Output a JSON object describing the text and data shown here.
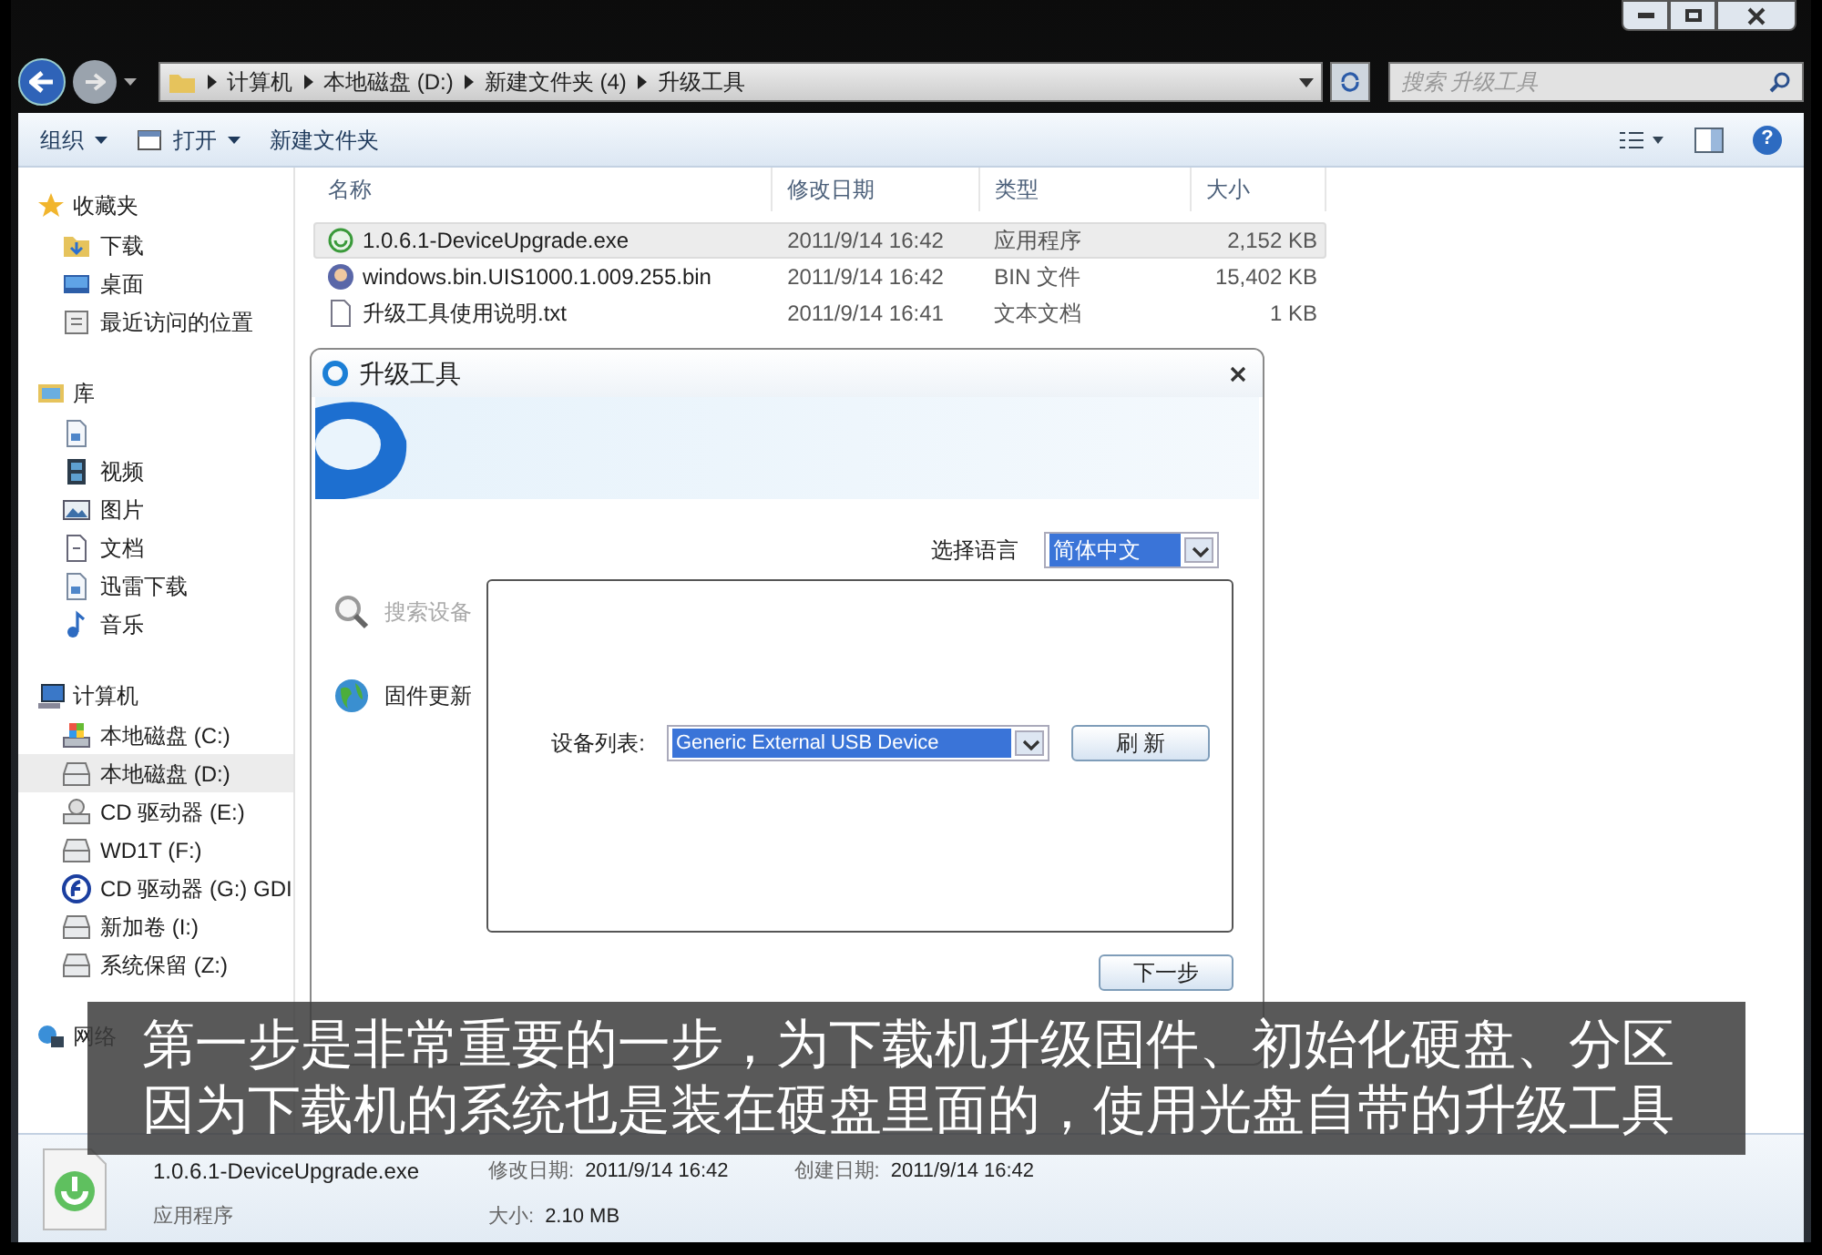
{
  "address_bar": {
    "crumbs": [
      "计算机",
      "本地磁盘 (D:)",
      "新建文件夹 (4)",
      "升级工具"
    ],
    "search": {
      "placeholder": "搜索 升级工具"
    }
  },
  "toolbar": [
    {
      "label": "组织",
      "dropdown": true,
      "kind": "text"
    },
    {
      "label": "打开",
      "dropdown": true,
      "kind": "open"
    },
    {
      "label": "新建文件夹",
      "dropdown": false,
      "kind": "text"
    }
  ],
  "sidebar": [
    {
      "label": "收藏夹",
      "kind": "star",
      "selected": false,
      "children": [
        {
          "label": "下载",
          "kind": "download",
          "selected": false
        },
        {
          "label": "桌面",
          "kind": "desktop",
          "selected": false
        },
        {
          "label": "最近访问的位置",
          "kind": "recent",
          "selected": false
        }
      ]
    },
    {
      "label": "库",
      "kind": "library",
      "selected": false,
      "children": [
        {
          "kind": "file",
          "selected": false
        },
        {
          "label": "视频",
          "kind": "video",
          "selected": false
        },
        {
          "label": "图片",
          "kind": "picture",
          "selected": false
        },
        {
          "label": "文档",
          "kind": "document",
          "selected": false
        },
        {
          "label": "迅雷下载",
          "kind": "file",
          "selected": false
        },
        {
          "label": "音乐",
          "kind": "music",
          "selected": false
        }
      ]
    },
    {
      "label": "计算机",
      "kind": "computer",
      "selected": false,
      "children": [
        {
          "label": "本地磁盘 (C:)",
          "kind": "system-drive",
          "selected": false
        },
        {
          "label": "本地磁盘 (D:)",
          "kind": "drive",
          "selected": true
        },
        {
          "label": "CD 驱动器 (E:)",
          "kind": "cd",
          "selected": false
        },
        {
          "label": "WD1T (F:)",
          "kind": "drive",
          "selected": false
        },
        {
          "label": "CD 驱动器 (G:) GDI",
          "kind": "disc-logo",
          "selected": false
        },
        {
          "label": "新加卷 (I:)",
          "kind": "drive",
          "selected": false
        },
        {
          "label": "系统保留 (Z:)",
          "kind": "drive",
          "selected": false
        }
      ]
    },
    {
      "label": "网络",
      "kind": "network",
      "selected": false
    }
  ],
  "help_button": "?",
  "file_list": {
    "columns": [
      "名称",
      "修改日期",
      "类型",
      "大小"
    ],
    "rows": [
      {
        "name": "1.0.6.1-DeviceUpgrade.exe",
        "date": "2011/9/14 16:42",
        "type": "应用程序",
        "size": "2,152 KB",
        "kind": "exe",
        "selected": true
      },
      {
        "name": "windows.bin.UIS1000.1.009.255.bin",
        "date": "2011/9/14 16:42",
        "type": "BIN 文件",
        "size": "15,402 KB",
        "kind": "bin",
        "selected": false
      },
      {
        "name": "升级工具使用说明.txt",
        "date": "2011/9/14 16:41",
        "type": "文本文档",
        "size": "1 KB",
        "kind": "txt",
        "selected": false
      }
    ]
  },
  "dialog": {
    "title": "升级工具",
    "language_label": "选择语言",
    "language_value": "简体中文",
    "side_items": [
      {
        "label": "搜索设备",
        "kind": "search",
        "disabled": true
      },
      {
        "label": "固件更新",
        "kind": "globe",
        "disabled": false
      }
    ],
    "device_label": "设备列表:",
    "device_value": "Generic External USB Device",
    "refresh_button": "刷 新",
    "next_button": "下一步"
  },
  "details_pane": {
    "name": "1.0.6.1-DeviceUpgrade.exe",
    "type": "应用程序",
    "fields": [
      {
        "label": "修改日期:",
        "value": "2011/9/14 16:42"
      },
      {
        "label": "创建日期:",
        "value": "2011/9/14 16:42"
      },
      {
        "label": "大小:",
        "value": "2.10 MB"
      }
    ]
  },
  "caption": [
    "第一步是非常重要的一步，为下载机升级固件、初始化硬盘、分区",
    "因为下载机的系统也是装在硬盘里面的，使用光盘自带的升级工具"
  ]
}
